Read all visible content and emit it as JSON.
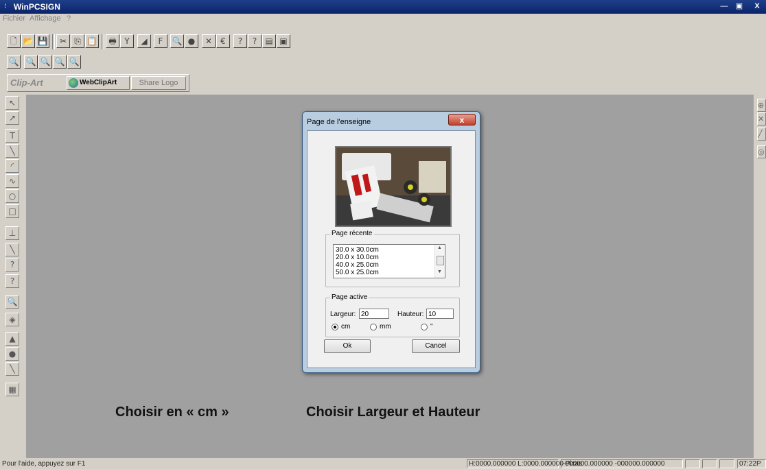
{
  "window": {
    "title": "WinPCSIGN",
    "minimize": "—",
    "maximize": "▣",
    "close": "X"
  },
  "menu": [
    "Fichier",
    "Affichage",
    "?"
  ],
  "toolbar3": {
    "clipart_label": "Clip-Art",
    "webclipart_label": "WebClipArt",
    "sharelogo_label": "Share Logo"
  },
  "dialog": {
    "title": "Page de l'enseigne",
    "close": "x",
    "recent_group": "Page récente",
    "recent_items": [
      "30.0 x 30.0cm",
      "20.0 x 10.0cm",
      "40.0 x 25.0cm",
      "50.0 x 25.0cm"
    ],
    "active_group": "Page active",
    "width_label": "Largeur:",
    "width_value": "20",
    "height_label": "Hauteur:",
    "height_value": "10",
    "unit_cm": "cm",
    "unit_mm": "mm",
    "unit_inch": "\"",
    "selected_unit": "cm",
    "ok": "Ok",
    "cancel": "Cancel"
  },
  "captions": {
    "left": "Choisir en « cm »",
    "right": "Choisir Largeur et Hauteur"
  },
  "status": {
    "help": "Pour l'aide, appuyez sur F1",
    "hl": "H:0000.000000  L:0000.000000 Picas",
    "coords": "-000000.000000 -000000.000000",
    "time": "07:22P"
  }
}
